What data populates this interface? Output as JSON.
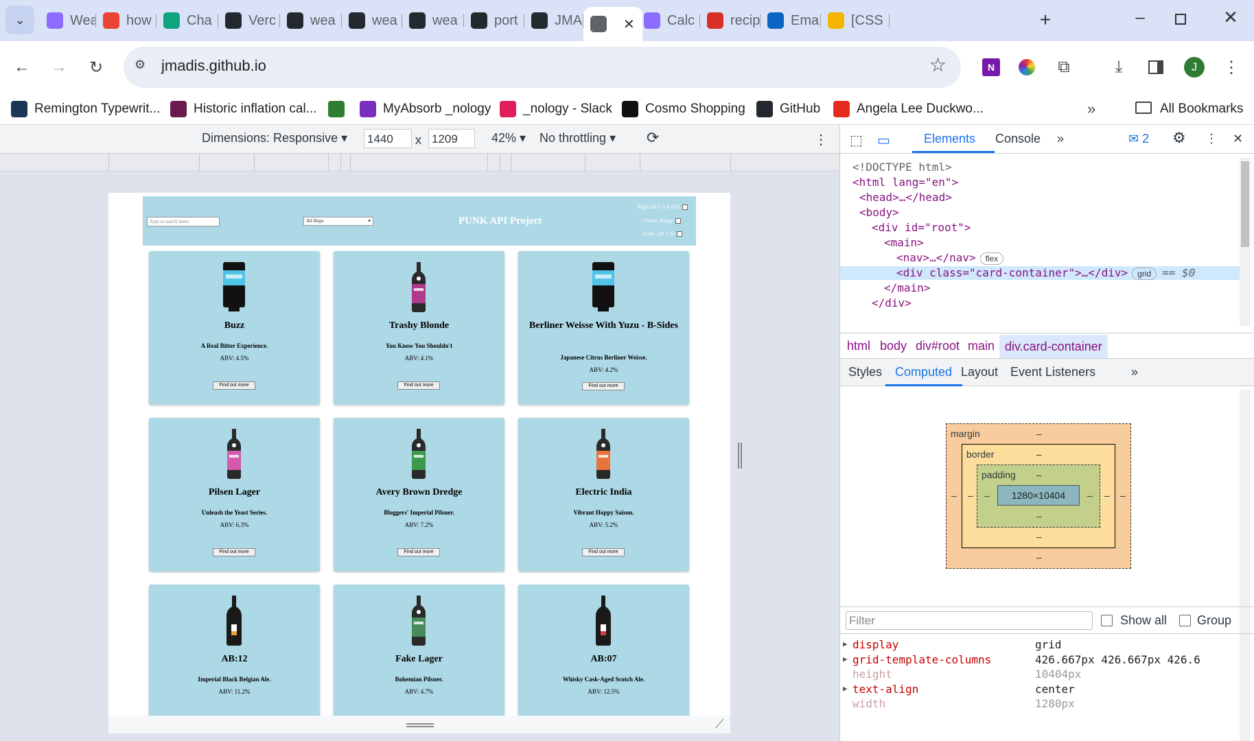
{
  "tabs": [
    {
      "label": "Wea",
      "icon": "vite-icon",
      "color": "#8c6cff"
    },
    {
      "label": "how",
      "icon": "google-icon",
      "color": "#ea4335"
    },
    {
      "label": "Cha",
      "icon": "chatgpt-icon",
      "color": "#10a37f"
    },
    {
      "label": "Verc",
      "icon": "github-icon",
      "color": "#24292f"
    },
    {
      "label": "wea",
      "icon": "github-icon",
      "color": "#24292f"
    },
    {
      "label": "wea",
      "icon": "github-icon",
      "color": "#24292f"
    },
    {
      "label": "wea",
      "icon": "github-icon",
      "color": "#24292f"
    },
    {
      "label": "port",
      "icon": "github-icon",
      "color": "#24292f"
    },
    {
      "label": "JMA",
      "icon": "github-icon",
      "color": "#24292f"
    },
    {
      "label": "",
      "icon": "globe-icon",
      "color": "#5f6368"
    },
    {
      "label": "Calc",
      "icon": "vite-icon",
      "color": "#8c6cff"
    },
    {
      "label": "recip",
      "icon": "gmail-icon",
      "color": "#d93025"
    },
    {
      "label": "Ema",
      "icon": "outlook-icon",
      "color": "#0a66c2"
    },
    {
      "label": "[CSS",
      "icon": "emoji-icon",
      "color": "#f4b400"
    }
  ],
  "address": {
    "url": "jmadis.github.io"
  },
  "profile_initial": "J",
  "bookmarks": [
    {
      "label": "Remington Typewrit...",
      "icon": "t-icon",
      "color": "#1d3557"
    },
    {
      "label": "Historic inflation cal...",
      "icon": "m-icon",
      "color": "#6a1b4d"
    },
    {
      "label": "",
      "icon": "wiki-icon",
      "color": "#2e7d32"
    },
    {
      "label": "MyAbsorb _nology",
      "icon": "nology-icon",
      "color": "#7b2fbf"
    },
    {
      "label": "_nology - Slack",
      "icon": "slack-icon",
      "color": "#e01e5a"
    },
    {
      "label": "Cosmo Shopping",
      "icon": "cosmo-icon",
      "color": "#111111"
    },
    {
      "label": "GitHub",
      "icon": "github-icon",
      "color": "#24292f"
    },
    {
      "label": "Angela Lee Duckwo...",
      "icon": "ted-icon",
      "color": "#e62b1e"
    }
  ],
  "all_bookmarks": "All Bookmarks",
  "device": {
    "dimensions_label": "Dimensions: Responsive",
    "width": "1440",
    "times": "x",
    "height": "1209",
    "zoom": "42%",
    "throttling": "No throttling"
  },
  "site": {
    "search_placeholder": "Type to search beers",
    "select_value": "All Hops",
    "title": "PUNK API Project",
    "filters": [
      "High ABV (>6.0%)",
      "Classic Range",
      "Acidic (ph < 4)"
    ]
  },
  "beers": [
    {
      "name": "Buzz",
      "tagline": "A Real Bitter Experience.",
      "abv": "ABV: 4.5%",
      "button": "Find out more",
      "type": "keg",
      "label_color": "#4fc3e8"
    },
    {
      "name": "Trashy Blonde",
      "tagline": "You Know You Shouldn't",
      "abv": "ABV: 4.1%",
      "button": "Find out more",
      "type": "bottle",
      "label_color": "#b03a8c"
    },
    {
      "name": "Berliner Weisse With Yuzu - B-Sides",
      "tagline": "Japanese Citrus Berliner Weisse.",
      "abv": "ABV: 4.2%",
      "button": "Find out more",
      "type": "keg",
      "label_color": "#4fc3e8"
    },
    {
      "name": "Pilsen Lager",
      "tagline": "Unleash the Yeast Series.",
      "abv": "ABV: 6.3%",
      "button": "Find out more",
      "type": "bottle",
      "label_color": "#d45ab0"
    },
    {
      "name": "Avery Brown Dredge",
      "tagline": "Bloggers' Imperial Pilsner.",
      "abv": "ABV: 7.2%",
      "button": "Find out more",
      "type": "bottle",
      "label_color": "#3c9a4a"
    },
    {
      "name": "Electric India",
      "tagline": "Vibrant Hoppy Saison.",
      "abv": "ABV: 5.2%",
      "button": "Find out more",
      "type": "bottle",
      "label_color": "#e8743b"
    },
    {
      "name": "AB:12",
      "tagline": "Imperial Black Belgian Ale.",
      "abv": "ABV: 11.2%",
      "button": "",
      "type": "tall",
      "label_color": "#e8a23b"
    },
    {
      "name": "Fake Lager",
      "tagline": "Bohemian Pilsner.",
      "abv": "ABV: 4.7%",
      "button": "",
      "type": "bottle",
      "label_color": "#4a8a5a"
    },
    {
      "name": "AB:07",
      "tagline": "Whisky Cask-Aged Scotch Ale.",
      "abv": "ABV: 12.5%",
      "button": "",
      "type": "tall",
      "label_color": "#d43b3b"
    }
  ],
  "devtools": {
    "tabs": [
      "Elements",
      "Console"
    ],
    "issues_count": "2",
    "dom": [
      {
        "text": "<!DOCTYPE html>"
      },
      {
        "text": "<html lang=\"en\">"
      },
      {
        "text": "<head>…</head>"
      },
      {
        "text": "<body>"
      },
      {
        "text": "<div id=\"root\">"
      },
      {
        "text": "<main>"
      },
      {
        "text": "<nav>…</nav>",
        "pill": "flex"
      },
      {
        "text": "<div class=\"card-container\">…</div>",
        "pill": "grid",
        "suffix": "== $0"
      },
      {
        "text": "</main>"
      },
      {
        "text": "</div>"
      }
    ],
    "breadcrumbs": [
      "html",
      "body",
      "div#root",
      "main",
      "div.card-container"
    ],
    "subtabs": [
      "Styles",
      "Computed",
      "Layout",
      "Event Listeners"
    ],
    "boxmodel": {
      "margin": "margin",
      "border": "border",
      "padding": "padding",
      "content": "1280×10404",
      "dash": "–"
    },
    "filter_placeholder": "Filter",
    "show_all": "Show all",
    "group": "Group",
    "computed": [
      {
        "prop": "display",
        "value": "grid",
        "active": true
      },
      {
        "prop": "grid-template-columns",
        "value": "426.667px 426.667px 426.6",
        "active": true
      },
      {
        "prop": "height",
        "value": "10404px",
        "active": false
      },
      {
        "prop": "text-align",
        "value": "center",
        "active": true
      },
      {
        "prop": "width",
        "value": "1280px",
        "active": false
      }
    ]
  }
}
